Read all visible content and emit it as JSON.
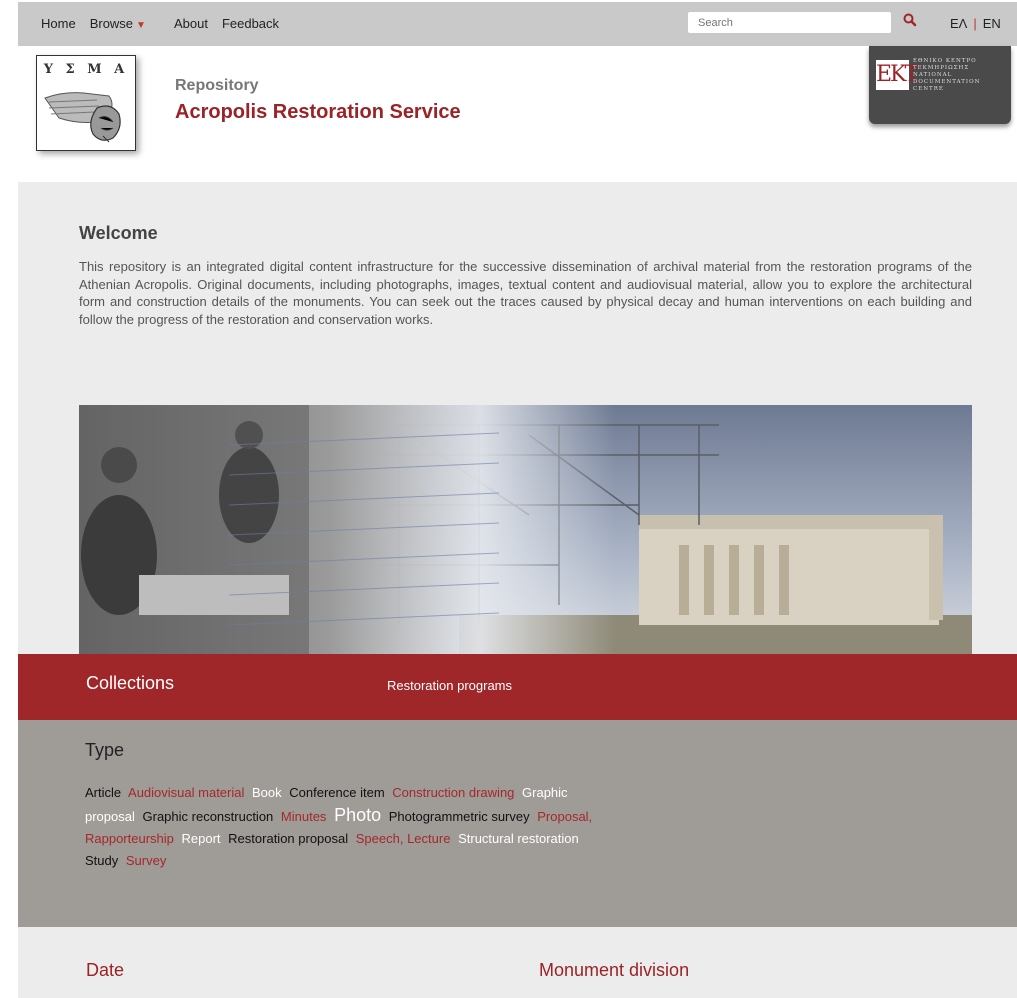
{
  "nav": {
    "items": [
      {
        "label": "Home"
      },
      {
        "label": "Browse"
      },
      {
        "label": "About"
      },
      {
        "label": "Feedback"
      }
    ],
    "search_placeholder": "Search",
    "lang_el": "ΕΛ",
    "lang_sep": "|",
    "lang_en": "EN"
  },
  "header": {
    "logo_text": "Υ Σ Μ Α",
    "repo_label": "Repository",
    "repo_title": "Acropolis Restoration Service",
    "ekt_monogram": "EKT",
    "ekt_lines": [
      "ΕΘΝΙΚΟ ΚΕΝΤΡΟ",
      "ΤΕΚΜΗΡΙΩΣΗΣ",
      "NATIONAL",
      "DOCUMENTATION",
      "CENTRE"
    ]
  },
  "welcome": {
    "title": "Welcome",
    "text": "This repository is an integrated digital content infrastructure for the successive dissemination of archival material from the restoration programs of the Athenian Acropolis. Original documents, including photographs, images, textual content and audiovisual material, allow you to explore the architectural form and construction details of the monuments. You can seek out the traces caused by physical decay and human interventions on each building and follow the progress of the restoration and conservation works."
  },
  "collections": {
    "title": "Collections",
    "link": "Restoration programs"
  },
  "types": {
    "title": "Type",
    "items": [
      {
        "label": "Article",
        "color": "dark"
      },
      {
        "label": "Audiovisual material",
        "color": "red"
      },
      {
        "label": "Book",
        "color": "white"
      },
      {
        "label": "Conference item",
        "color": "dark"
      },
      {
        "label": "Construction drawing",
        "color": "red"
      },
      {
        "label": "Graphic proposal",
        "color": "white"
      },
      {
        "label": "Graphic reconstruction",
        "color": "dark"
      },
      {
        "label": "Minutes",
        "color": "red"
      },
      {
        "label": "Photo",
        "color": "white",
        "big": true
      },
      {
        "label": "Photogrammetric survey",
        "color": "dark"
      },
      {
        "label": "Proposal, Rapporteurship",
        "color": "red"
      },
      {
        "label": "Report",
        "color": "white"
      },
      {
        "label": "Restoration proposal",
        "color": "dark"
      },
      {
        "label": "Speech, Lecture",
        "color": "red"
      },
      {
        "label": "Structural restoration",
        "color": "white"
      },
      {
        "label": "Study",
        "color": "dark"
      },
      {
        "label": "Survey",
        "color": "red"
      }
    ]
  },
  "bottom": {
    "date_title": "Date",
    "monument_title": "Monument division"
  },
  "colors": {
    "accent": "#9f2629",
    "nav_bg": "#c9c9c9",
    "type_bg": "#9f9b97"
  }
}
